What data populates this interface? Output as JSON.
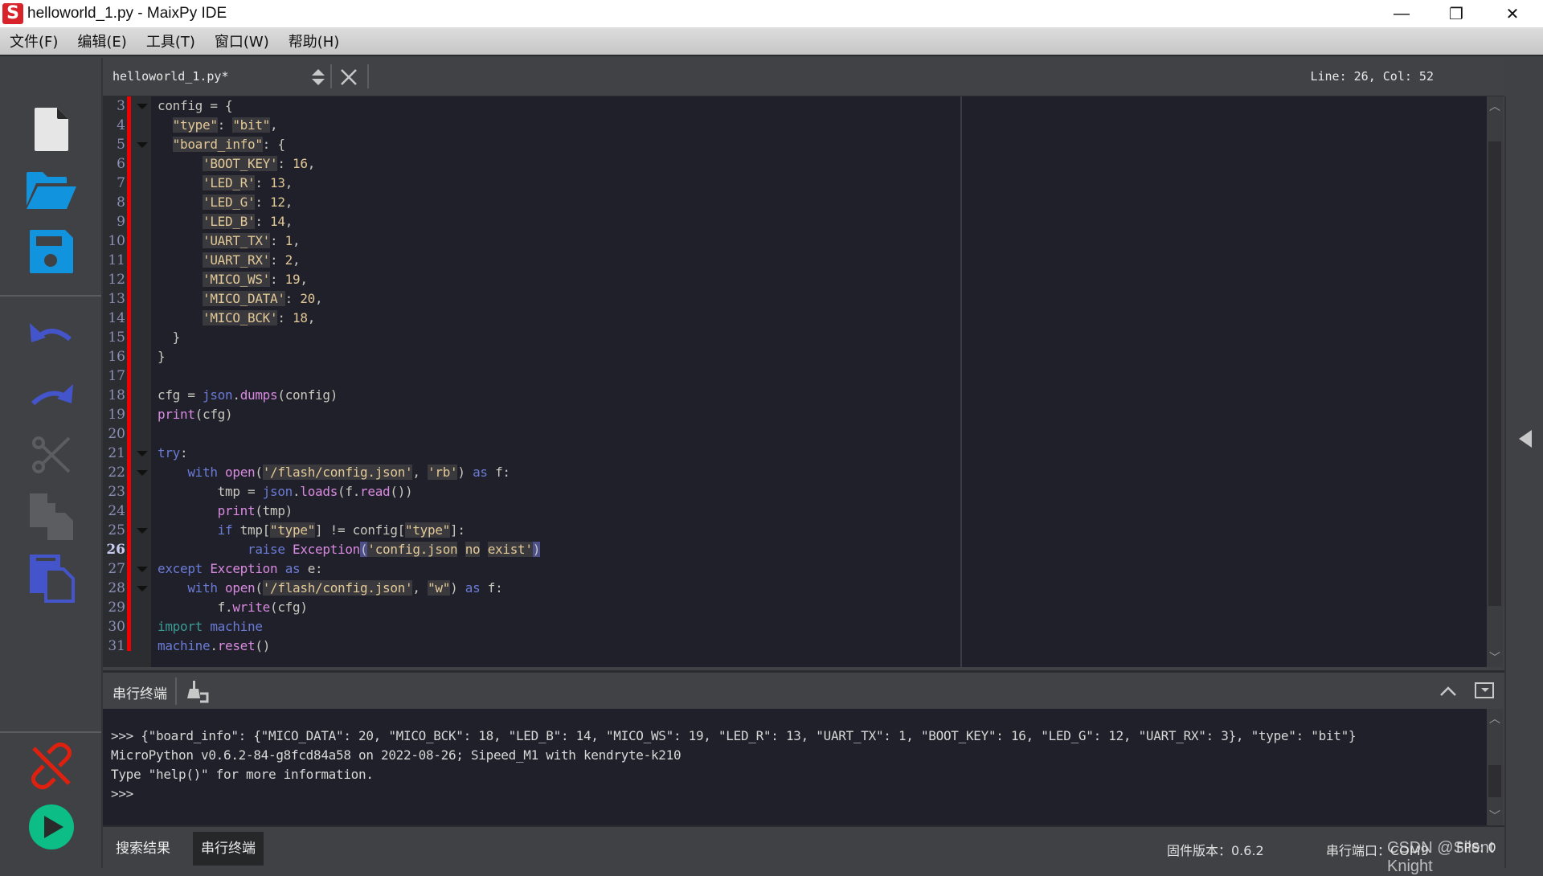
{
  "window": {
    "title": "helloworld_1.py - MaixPy IDE",
    "logo_letter": "S",
    "controls": {
      "minimize": "—",
      "maximize": "❐",
      "close": "✕"
    }
  },
  "menu": [
    "文件(F)",
    "编辑(E)",
    "工具(T)",
    "窗口(W)",
    "帮助(H)"
  ],
  "toolbar": {
    "buttons": [
      "new-file",
      "open-file",
      "save-file",
      "undo",
      "redo",
      "cut",
      "copy",
      "paste",
      "disconnect",
      "run"
    ],
    "colors": {
      "file_blue": "#1293dd",
      "edit_blue": "#4455cc",
      "disabled": "#5c5d60",
      "disconnect_red": "#e0200e",
      "run_green": "#0cbd86"
    }
  },
  "editor": {
    "file_tab": "helloworld_1.py*",
    "cursor_position": "Line: 26, Col: 52",
    "current_line": 26,
    "first_line_number": 3,
    "fold_lines": [
      3,
      5,
      21,
      22,
      25,
      27,
      28
    ],
    "lines": [
      [
        [
          "",
          "config = {"
        ]
      ],
      [
        [
          "",
          "  "
        ],
        [
          "str",
          "\"type\""
        ],
        [
          "",
          ": "
        ],
        [
          "str",
          "\"bit\""
        ],
        [
          "",
          ","
        ]
      ],
      [
        [
          "",
          "  "
        ],
        [
          "str",
          "\"board_info\""
        ],
        [
          "",
          ": {"
        ]
      ],
      [
        [
          "",
          "      "
        ],
        [
          "str",
          "'BOOT_KEY'"
        ],
        [
          "",
          ": "
        ],
        [
          "num",
          "16"
        ],
        [
          "",
          ","
        ]
      ],
      [
        [
          "",
          "      "
        ],
        [
          "str",
          "'LED_R'"
        ],
        [
          "",
          ": "
        ],
        [
          "num",
          "13"
        ],
        [
          "",
          ","
        ]
      ],
      [
        [
          "",
          "      "
        ],
        [
          "str",
          "'LED_G'"
        ],
        [
          "",
          ": "
        ],
        [
          "num",
          "12"
        ],
        [
          "",
          ","
        ]
      ],
      [
        [
          "",
          "      "
        ],
        [
          "str",
          "'LED_B'"
        ],
        [
          "",
          ": "
        ],
        [
          "num",
          "14"
        ],
        [
          "",
          ","
        ]
      ],
      [
        [
          "",
          "      "
        ],
        [
          "str",
          "'UART_TX'"
        ],
        [
          "",
          ": "
        ],
        [
          "num",
          "1"
        ],
        [
          "",
          ","
        ]
      ],
      [
        [
          "",
          "      "
        ],
        [
          "str",
          "'UART_RX'"
        ],
        [
          "",
          ": "
        ],
        [
          "num",
          "2"
        ],
        [
          "",
          ","
        ]
      ],
      [
        [
          "",
          "      "
        ],
        [
          "str",
          "'MICO_WS'"
        ],
        [
          "",
          ": "
        ],
        [
          "num",
          "19"
        ],
        [
          "",
          ","
        ]
      ],
      [
        [
          "",
          "      "
        ],
        [
          "str",
          "'MICO_DATA'"
        ],
        [
          "",
          ": "
        ],
        [
          "num",
          "20"
        ],
        [
          "",
          ","
        ]
      ],
      [
        [
          "",
          "      "
        ],
        [
          "str",
          "'MICO_BCK'"
        ],
        [
          "",
          ": "
        ],
        [
          "num",
          "18"
        ],
        [
          "",
          ","
        ]
      ],
      [
        [
          "",
          "  }"
        ]
      ],
      [
        [
          "",
          "}"
        ]
      ],
      [
        [
          "",
          ""
        ]
      ],
      [
        [
          "",
          "cfg = "
        ],
        [
          "kw",
          "json"
        ],
        [
          "",
          "."
        ],
        [
          "fn",
          "dumps"
        ],
        [
          "",
          "(config)"
        ]
      ],
      [
        [
          "fn",
          "print"
        ],
        [
          "",
          "(cfg)"
        ]
      ],
      [
        [
          "",
          ""
        ]
      ],
      [
        [
          "kw",
          "try"
        ],
        [
          "",
          ":"
        ]
      ],
      [
        [
          "",
          "    "
        ],
        [
          "kw",
          "with"
        ],
        [
          "",
          " "
        ],
        [
          "fn",
          "open"
        ],
        [
          "",
          "("
        ],
        [
          "str",
          "'/flash/config.json'"
        ],
        [
          "",
          ", "
        ],
        [
          "str",
          "'rb'"
        ],
        [
          "",
          ") "
        ],
        [
          "kw",
          "as"
        ],
        [
          "",
          " f:"
        ]
      ],
      [
        [
          "",
          "        tmp = "
        ],
        [
          "kw",
          "json"
        ],
        [
          "",
          "."
        ],
        [
          "fn",
          "loads"
        ],
        [
          "",
          "(f."
        ],
        [
          "fn",
          "read"
        ],
        [
          "",
          "())"
        ]
      ],
      [
        [
          "",
          "        "
        ],
        [
          "fn",
          "print"
        ],
        [
          "",
          "(tmp)"
        ]
      ],
      [
        [
          "",
          "        "
        ],
        [
          "kw",
          "if"
        ],
        [
          "",
          " tmp["
        ],
        [
          "str",
          "\"type\""
        ],
        [
          "",
          "] != config["
        ],
        [
          "str",
          "\"type\""
        ],
        [
          "",
          "]:"
        ]
      ],
      [
        [
          "",
          "            "
        ],
        [
          "kw",
          "raise"
        ],
        [
          "",
          " "
        ],
        [
          "fn",
          "Exception"
        ],
        [
          "sel",
          "("
        ],
        [
          "str",
          "'config.json"
        ],
        [
          "",
          " "
        ],
        [
          "str",
          "no"
        ],
        [
          "",
          " "
        ],
        [
          "str",
          "exist'"
        ],
        [
          "sel",
          ")"
        ]
      ],
      [
        [
          "kw",
          "except"
        ],
        [
          "",
          " "
        ],
        [
          "fn",
          "Exception"
        ],
        [
          "",
          " "
        ],
        [
          "kw",
          "as"
        ],
        [
          "",
          " e:"
        ]
      ],
      [
        [
          "",
          "    "
        ],
        [
          "kw",
          "with"
        ],
        [
          "",
          " "
        ],
        [
          "fn",
          "open"
        ],
        [
          "",
          "("
        ],
        [
          "str",
          "'/flash/config.json'"
        ],
        [
          "",
          ", "
        ],
        [
          "str",
          "\"w\""
        ],
        [
          "",
          ") "
        ],
        [
          "kw",
          "as"
        ],
        [
          "",
          " f:"
        ]
      ],
      [
        [
          "",
          "        f."
        ],
        [
          "fn",
          "write"
        ],
        [
          "",
          "(cfg)"
        ]
      ],
      [
        [
          "imp",
          "import"
        ],
        [
          "",
          " "
        ],
        [
          "kw",
          "machine"
        ]
      ],
      [
        [
          "kw",
          "machine"
        ],
        [
          "",
          "."
        ],
        [
          "fn",
          "reset"
        ],
        [
          "",
          "()"
        ]
      ]
    ]
  },
  "terminal": {
    "title": "串行终端",
    "lines": [
      ">>> {\"board_info\": {\"MICO_DATA\": 20, \"MICO_BCK\": 18, \"LED_B\": 14, \"MICO_WS\": 19, \"LED_R\": 13, \"UART_TX\": 1, \"BOOT_KEY\": 16, \"LED_G\": 12, \"UART_RX\": 3}, \"type\": \"bit\"}",
      "MicroPython v0.6.2-84-g8fcd84a58 on 2022-08-26; Sipeed_M1 with kendryte-k210",
      "Type \"help()\" for more information.",
      ">>>"
    ]
  },
  "statusbar": {
    "tabs": [
      "搜索结果",
      "串行终端"
    ],
    "active_tab": "串行终端",
    "firmware_version": "固件版本：0.6.2",
    "serial_port": "串行端口：COM9",
    "fps": "FPS: 0"
  },
  "watermark": "CSDN @Silent Knight"
}
